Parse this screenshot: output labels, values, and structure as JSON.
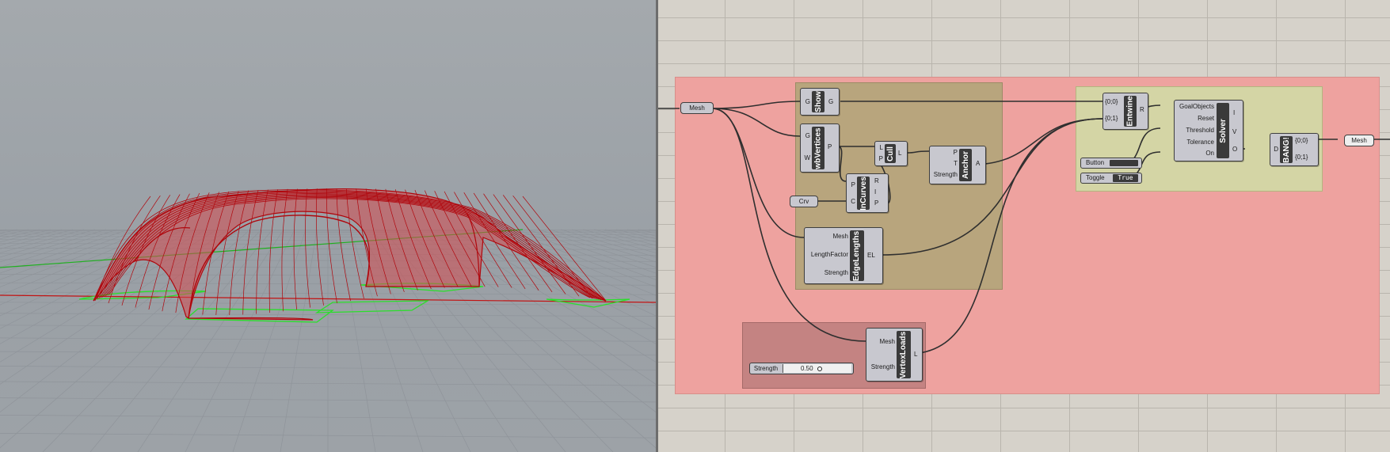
{
  "viewport": {
    "colors": {
      "mesh_edge": "#b0060c",
      "mesh_fill": "#d44a4f",
      "anchor_lines": "#2bde2b",
      "grid": "#8f949a",
      "axis_x": "#c21313",
      "axis_y": "#20b020"
    }
  },
  "canvas": {
    "groups": {
      "main_color": "#eea29f",
      "anchor_color": "#b8a57d",
      "loads_color": "#c48382",
      "solver_color": "#d4d5a5"
    },
    "mesh_param": {
      "label": "Mesh"
    },
    "show": {
      "name": "Show",
      "inputs": [
        "G"
      ],
      "outputs": [
        "G"
      ]
    },
    "wbvertices": {
      "name": "wbVertices",
      "inputs": [
        "G",
        "W"
      ],
      "outputs": [
        "P"
      ]
    },
    "cull": {
      "name": "Cull",
      "inputs": [
        "L",
        "P"
      ],
      "outputs": [
        "L"
      ]
    },
    "incurves": {
      "name": "InCurves",
      "inputs": [
        "P",
        "C"
      ],
      "outputs": [
        "R",
        "I",
        "P"
      ]
    },
    "crv_param": {
      "label": "Crv"
    },
    "anchor": {
      "name": "Anchor",
      "inputs": [
        "P",
        "T",
        "Strength"
      ],
      "outputs": [
        "A"
      ]
    },
    "edgelengths": {
      "name": "EdgeLengths",
      "inputs": [
        "Mesh",
        "LengthFactor",
        "Strength"
      ],
      "outputs": [
        "EL"
      ]
    },
    "vertexloads": {
      "name": "VertexLoads",
      "inputs": [
        "Mesh",
        "Strength"
      ],
      "outputs": [
        "L"
      ]
    },
    "slider": {
      "label": "Strength",
      "value": "0.50"
    },
    "entwine": {
      "name": "Entwine",
      "inputs": [
        "{0;0}",
        "{0;1}"
      ],
      "outputs": [
        "R"
      ]
    },
    "solver": {
      "name": "Solver",
      "inputs": [
        "GoalObjects",
        "Reset",
        "Threshold",
        "Tolerance",
        "On"
      ],
      "outputs": [
        "I",
        "V",
        "O"
      ]
    },
    "button": {
      "label": "Button"
    },
    "toggle": {
      "label": "Toggle",
      "value": "True"
    },
    "bang": {
      "name": "BANG!",
      "inputs": [
        "D"
      ],
      "outputs": [
        "{0;0}",
        "{0;1}"
      ]
    },
    "out_mesh": {
      "label": "Mesh"
    }
  }
}
